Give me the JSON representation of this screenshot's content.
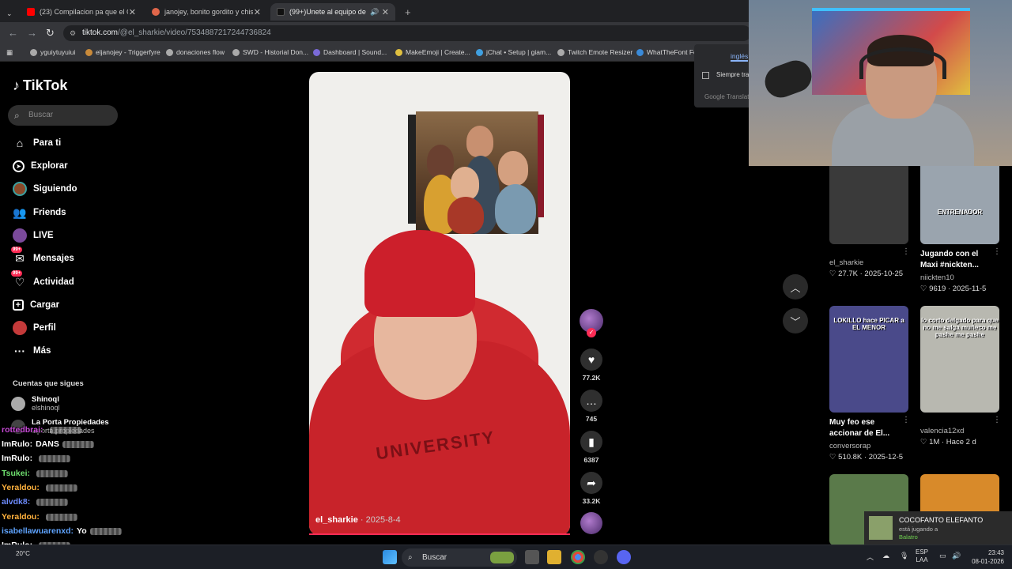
{
  "browser": {
    "tabs": [
      {
        "title": "(23) Compilacion pa que el Cris",
        "active": false,
        "fav_color": "#ff0000"
      },
      {
        "title": "janojey, bonito gordito y chisto",
        "active": false,
        "fav_color": "#e0664a"
      },
      {
        "title": "(99+)Unete al equipo de Ar",
        "active": true,
        "fav_color": "#111111"
      }
    ],
    "url_host": "tiktok.com",
    "url_path": "/@el_sharkie/video/7534887217244736824",
    "bookmarks": [
      "yguiytuyuiui",
      "eljanojey - Triggerfyre",
      "donaciones flow",
      "SWD - Historial Don...",
      "Dashboard | Sound...",
      "MakeEmoji | Create...",
      "jChat • Setup | giam...",
      "Twitch Emote Resizer",
      "WhatTheFont Fo"
    ],
    "translate": {
      "lang": "inglés",
      "checkbox": "Siempre tra",
      "footer": "Google Translat"
    }
  },
  "sidebar": {
    "logo": "TikTok",
    "search_placeholder": "Buscar",
    "nav": [
      {
        "label": "Para ti",
        "icon": "home-icon"
      },
      {
        "label": "Explorar",
        "icon": "compass-icon"
      },
      {
        "label": "Siguiendo",
        "icon": "following-avatar-icon"
      },
      {
        "label": "Friends",
        "icon": "friends-icon"
      },
      {
        "label": "LIVE",
        "icon": "live-icon"
      },
      {
        "label": "Mensajes",
        "icon": "messages-icon",
        "badge": "99+"
      },
      {
        "label": "Actividad",
        "icon": "activity-icon",
        "badge": "99+"
      },
      {
        "label": "Cargar",
        "icon": "upload-icon"
      },
      {
        "label": "Perfil",
        "icon": "profile-icon"
      },
      {
        "label": "Más",
        "icon": "more-icon"
      }
    ],
    "following_header": "Cuentas que sigues",
    "following": [
      {
        "name": "Shinoql",
        "handle": "elshinoql"
      },
      {
        "name": "La Porta Propiedades",
        "handle": "laporta.propiedades"
      }
    ]
  },
  "chat": [
    {
      "user": "rottedbrai:",
      "msg": "",
      "color": "#c94ad8"
    },
    {
      "user": "ImRulo:",
      "msg": "DANS",
      "color": "#ffffff"
    },
    {
      "user": "ImRulo:",
      "msg": "",
      "color": "#ffffff"
    },
    {
      "user": "Tsukei:",
      "msg": "",
      "color": "#6fe06f"
    },
    {
      "user": "Yeraldou:",
      "msg": "",
      "color": "#ffb13d"
    },
    {
      "user": "alvdk8:",
      "msg": "",
      "color": "#6e8cff"
    },
    {
      "user": "Yeraldou:",
      "msg": "",
      "color": "#ffb13d"
    },
    {
      "user": "isabellawuarenxd:",
      "msg": "Yo",
      "color": "#5fa4ff"
    },
    {
      "user": "ImRulo:",
      "msg": "",
      "color": "#ffffff"
    },
    {
      "user": "isabellawuarenxd:",
      "msg": "",
      "color": "#5fa4ff"
    }
  ],
  "video": {
    "author": "el_sharkie",
    "date": "· 2025-8-4",
    "shirt_text": "UNIVERSITY",
    "likes": "77.2K",
    "comments": "745",
    "saves": "6387",
    "shares": "33.2K"
  },
  "recommendations": [
    {
      "title": "",
      "author": "el_sharkie",
      "stats": "♡ 27.7K · 2025-10-25",
      "caption": "",
      "thumb_color": "#3a3a3a"
    },
    {
      "title": "Jugando con el Maxi #nickten...",
      "author": "niickten10",
      "stats": "♡ 9619 · 2025-11-5",
      "caption": "ENTRENADOR",
      "thumb_color": "#9aa4ae"
    },
    {
      "title": "Muy feo ese accionar de El...",
      "author": "conversorap",
      "stats": "♡ 510.8K · 2025-12-5",
      "caption": "LOKILLO hace PICAR a EL MENOR",
      "thumb_color": "#4a4a8a"
    },
    {
      "title": "",
      "author": "valencia12xd",
      "stats": "♡ 1M · Hace 2 d",
      "caption": "lo corto delgado para que no me salga muñeco me pashe me pashe",
      "thumb_color": "#b8b8b0"
    },
    {
      "title": "",
      "author": "",
      "stats": "",
      "caption": "",
      "thumb_color": "#5a7a4a"
    },
    {
      "title": "",
      "author": "",
      "stats": "",
      "caption": "",
      "thumb_color": "#d88a2a"
    }
  ],
  "notification": {
    "title": "COCOFANTO ELEFANTO",
    "sub": "está jugando a",
    "game": "Balatro"
  },
  "taskbar": {
    "search": "Buscar",
    "weather": "20°C",
    "lang_top": "ESP",
    "lang_bottom": "LAA",
    "time": "23:43",
    "date": "08-01-2026"
  }
}
